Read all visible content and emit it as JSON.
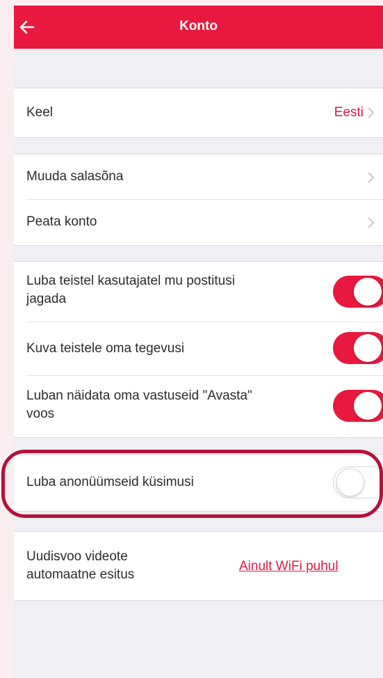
{
  "header": {
    "title": "Konto"
  },
  "language": {
    "label": "Keel",
    "value": "Eesti"
  },
  "account": {
    "change_password": "Muuda salasõna",
    "hide_account": "Peata konto"
  },
  "privacy": [
    {
      "label": "Luba teistel kasutajatel mu postitusi jagada",
      "on": true
    },
    {
      "label": "Kuva teistele oma tegevusi",
      "on": true
    },
    {
      "label": "Luban näidata oma vastuseid \"Avasta\" voos",
      "on": true
    }
  ],
  "anonymous": {
    "label": "Luba anonüümseid küsimusi",
    "on": false
  },
  "video": {
    "label": "Uudisvoo videote automaatne esitus",
    "value": "Ainult WiFi puhul"
  },
  "colors": {
    "accent": "#e8183e",
    "highlight": "#b5103a",
    "background": "#efeff4"
  }
}
